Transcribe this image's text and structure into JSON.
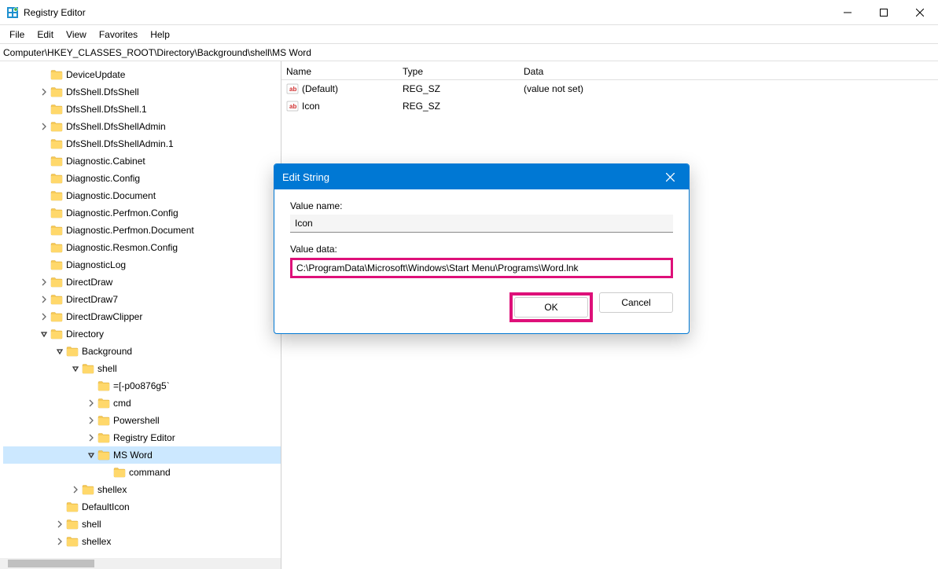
{
  "window": {
    "title": "Registry Editor"
  },
  "menu": {
    "file": "File",
    "edit": "Edit",
    "view": "View",
    "favorites": "Favorites",
    "help": "Help"
  },
  "addressbar": "Computer\\HKEY_CLASSES_ROOT\\Directory\\Background\\shell\\MS Word",
  "tree": {
    "items": [
      {
        "indent": 2,
        "exp": "none",
        "label": "DeviceUpdate"
      },
      {
        "indent": 2,
        "exp": "closed",
        "label": "DfsShell.DfsShell"
      },
      {
        "indent": 2,
        "exp": "none",
        "label": "DfsShell.DfsShell.1"
      },
      {
        "indent": 2,
        "exp": "closed",
        "label": "DfsShell.DfsShellAdmin"
      },
      {
        "indent": 2,
        "exp": "none",
        "label": "DfsShell.DfsShellAdmin.1"
      },
      {
        "indent": 2,
        "exp": "none",
        "label": "Diagnostic.Cabinet"
      },
      {
        "indent": 2,
        "exp": "none",
        "label": "Diagnostic.Config"
      },
      {
        "indent": 2,
        "exp": "none",
        "label": "Diagnostic.Document"
      },
      {
        "indent": 2,
        "exp": "none",
        "label": "Diagnostic.Perfmon.Config"
      },
      {
        "indent": 2,
        "exp": "none",
        "label": "Diagnostic.Perfmon.Document"
      },
      {
        "indent": 2,
        "exp": "none",
        "label": "Diagnostic.Resmon.Config"
      },
      {
        "indent": 2,
        "exp": "none",
        "label": "DiagnosticLog"
      },
      {
        "indent": 2,
        "exp": "closed",
        "label": "DirectDraw"
      },
      {
        "indent": 2,
        "exp": "closed",
        "label": "DirectDraw7"
      },
      {
        "indent": 2,
        "exp": "closed",
        "label": "DirectDrawClipper"
      },
      {
        "indent": 2,
        "exp": "open",
        "label": "Directory"
      },
      {
        "indent": 3,
        "exp": "open",
        "label": "Background"
      },
      {
        "indent": 4,
        "exp": "open",
        "label": "shell"
      },
      {
        "indent": 5,
        "exp": "none",
        "label": "=[-p0o876g5`"
      },
      {
        "indent": 5,
        "exp": "closed",
        "label": "cmd"
      },
      {
        "indent": 5,
        "exp": "closed",
        "label": "Powershell"
      },
      {
        "indent": 5,
        "exp": "closed",
        "label": "Registry Editor"
      },
      {
        "indent": 5,
        "exp": "open",
        "label": "MS Word",
        "selected": true
      },
      {
        "indent": 6,
        "exp": "none",
        "label": "command"
      },
      {
        "indent": 4,
        "exp": "closed",
        "label": "shellex"
      },
      {
        "indent": 3,
        "exp": "none",
        "label": "DefaultIcon"
      },
      {
        "indent": 3,
        "exp": "closed",
        "label": "shell"
      },
      {
        "indent": 3,
        "exp": "closed",
        "label": "shellex"
      }
    ]
  },
  "list": {
    "headers": {
      "name": "Name",
      "type": "Type",
      "data": "Data"
    },
    "rows": [
      {
        "name": "(Default)",
        "type": "REG_SZ",
        "data": "(value not set)"
      },
      {
        "name": "Icon",
        "type": "REG_SZ",
        "data": ""
      }
    ]
  },
  "dialog": {
    "title": "Edit String",
    "value_name_label": "Value name:",
    "value_name": "Icon",
    "value_data_label": "Value data:",
    "value_data": "C:\\ProgramData\\Microsoft\\Windows\\Start Menu\\Programs\\Word.lnk",
    "ok_label": "OK",
    "cancel_label": "Cancel"
  }
}
